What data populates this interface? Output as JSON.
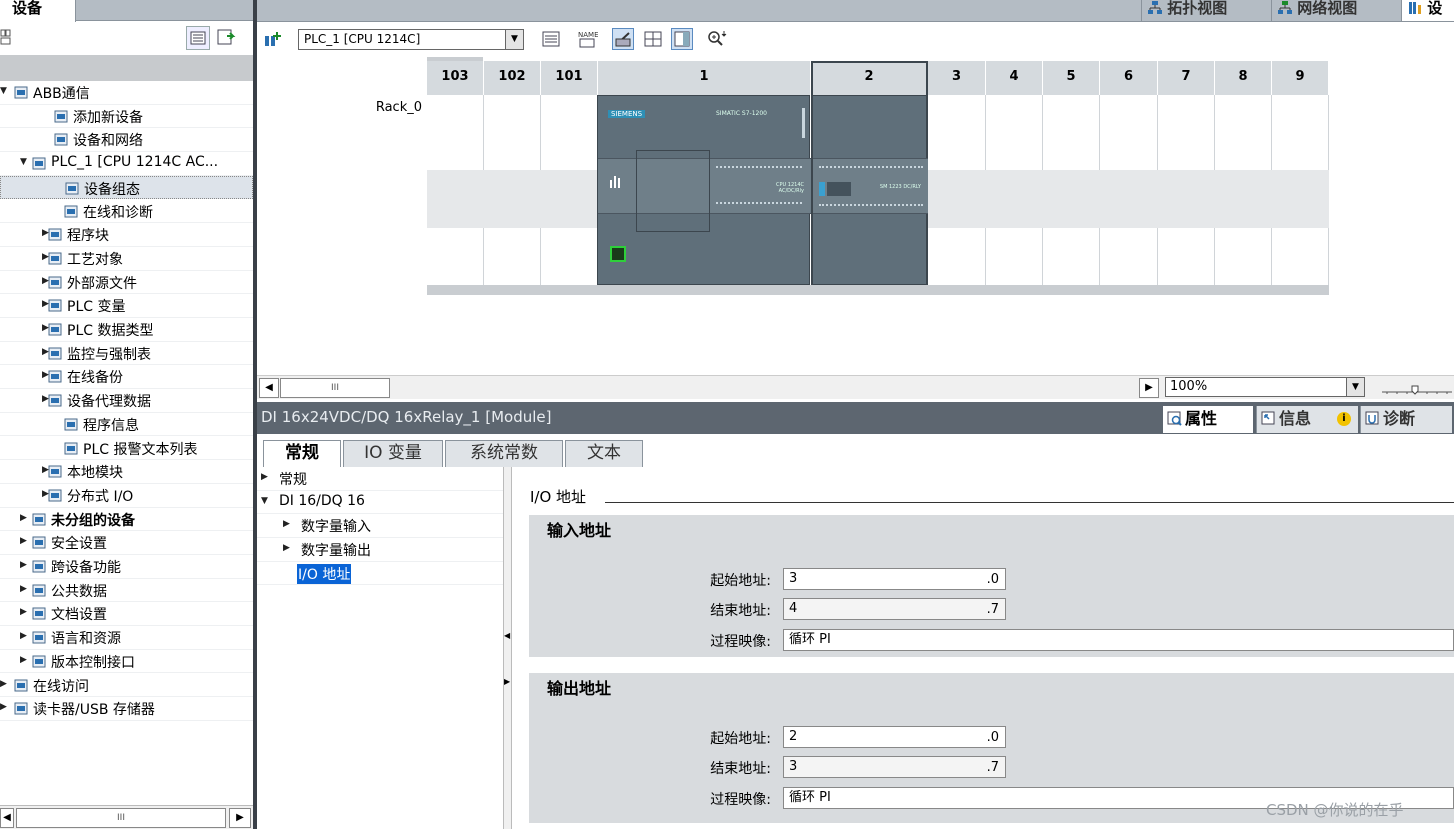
{
  "left_panel": {
    "tab_label": "设备",
    "toolbar_label": "设备",
    "tree": [
      {
        "label": "ABB通信",
        "level": 0,
        "arrow": "▼",
        "icon": "project-icon",
        "bold": false
      },
      {
        "label": "添加新设备",
        "level": 2,
        "arrow": "",
        "icon": "add-device-icon",
        "bold": false
      },
      {
        "label": "设备和网络",
        "level": 2,
        "arrow": "",
        "icon": "network-icon",
        "bold": false
      },
      {
        "label": "PLC_1 [CPU 1214C AC...",
        "level": 1,
        "arrow": "▼",
        "icon": "plc-icon",
        "bold": false
      },
      {
        "label": "设备组态",
        "level": 3,
        "arrow": "",
        "icon": "device-config-icon",
        "bold": false,
        "selected": true
      },
      {
        "label": "在线和诊断",
        "level": 3,
        "arrow": "",
        "icon": "diagnostics-icon",
        "bold": false
      },
      {
        "label": "程序块",
        "level": 2,
        "arrow": "▶",
        "icon": "program-blocks-icon",
        "bold": false
      },
      {
        "label": "工艺对象",
        "level": 2,
        "arrow": "▶",
        "icon": "technology-objects-icon",
        "bold": false
      },
      {
        "label": "外部源文件",
        "level": 2,
        "arrow": "▶",
        "icon": "external-source-icon",
        "bold": false
      },
      {
        "label": "PLC 变量",
        "level": 2,
        "arrow": "▶",
        "icon": "plc-tags-icon",
        "bold": false
      },
      {
        "label": "PLC 数据类型",
        "level": 2,
        "arrow": "▶",
        "icon": "plc-datatypes-icon",
        "bold": false
      },
      {
        "label": "监控与强制表",
        "level": 2,
        "arrow": "▶",
        "icon": "watch-table-icon",
        "bold": false
      },
      {
        "label": "在线备份",
        "level": 2,
        "arrow": "▶",
        "icon": "online-backup-icon",
        "bold": false
      },
      {
        "label": "设备代理数据",
        "level": 2,
        "arrow": "▶",
        "icon": "device-proxy-icon",
        "bold": false
      },
      {
        "label": "程序信息",
        "level": 3,
        "arrow": "",
        "icon": "program-info-icon",
        "bold": false
      },
      {
        "label": "PLC 报警文本列表",
        "level": 3,
        "arrow": "",
        "icon": "alarm-text-icon",
        "bold": false
      },
      {
        "label": "本地模块",
        "level": 2,
        "arrow": "▶",
        "icon": "local-modules-icon",
        "bold": false
      },
      {
        "label": "分布式 I/O",
        "level": 2,
        "arrow": "▶",
        "icon": "distributed-io-icon",
        "bold": false
      },
      {
        "label": "未分组的设备",
        "level": 1,
        "arrow": "▶",
        "icon": "ungrouped-devices-icon",
        "bold": true
      },
      {
        "label": "安全设置",
        "level": 1,
        "arrow": "▶",
        "icon": "security-icon",
        "bold": false
      },
      {
        "label": "跨设备功能",
        "level": 1,
        "arrow": "▶",
        "icon": "cross-device-icon",
        "bold": false
      },
      {
        "label": "公共数据",
        "level": 1,
        "arrow": "▶",
        "icon": "common-data-icon",
        "bold": false
      },
      {
        "label": "文档设置",
        "level": 1,
        "arrow": "▶",
        "icon": "document-settings-icon",
        "bold": false
      },
      {
        "label": "语言和资源",
        "level": 1,
        "arrow": "▶",
        "icon": "languages-icon",
        "bold": false
      },
      {
        "label": "版本控制接口",
        "level": 1,
        "arrow": "▶",
        "icon": "version-control-icon",
        "bold": false
      },
      {
        "label": "在线访问",
        "level": 0,
        "arrow": "▶",
        "icon": "online-access-icon",
        "bold": false
      },
      {
        "label": "读卡器/USB 存储器",
        "level": 0,
        "arrow": "▶",
        "icon": "card-reader-icon",
        "bold": false
      }
    ],
    "hscroll_thumb": "III"
  },
  "view_tabs": [
    {
      "label": "拓扑视图",
      "icon": "topology-icon"
    },
    {
      "label": "网络视图",
      "icon": "network-view-icon"
    },
    {
      "label": "设",
      "icon": "device-view-icon"
    }
  ],
  "device_toolbar": {
    "plc_select": "PLC_1 [CPU 1214C]",
    "icons": [
      "select-device-icon",
      "dropdown-arrow-icon",
      "module-overview-icon",
      "name-icon",
      "show-modules-icon",
      "grid-icon",
      "panel-icon",
      "zoom-icon"
    ]
  },
  "rack": {
    "name": "Rack_0",
    "slots": [
      "103",
      "102",
      "101",
      "1",
      "2",
      "3",
      "4",
      "5",
      "6",
      "7",
      "8",
      "9"
    ],
    "cpu_brand": "SIEMENS",
    "cpu_model": "SIMATIC S7-1200",
    "cpu_type": "CPU 1214C AC/DC/Rly",
    "sm_model": "SM 1223 DC/RLY"
  },
  "zoom": {
    "value": "100%"
  },
  "inspector": {
    "title": "DI 16x24VDC/DQ 16xRelay_1 [Module]",
    "tabs": [
      {
        "label": "属性",
        "icon": "properties-icon",
        "active": true
      },
      {
        "label": "信息",
        "icon": "info-icon",
        "active": false
      },
      {
        "label": "诊断",
        "icon": "diagnostics-tab-icon",
        "active": false
      }
    ],
    "prop_tabs": [
      "常规",
      "IO 变量",
      "系统常数",
      "文本"
    ],
    "nav": [
      {
        "label": "常规",
        "arrow": "▶",
        "level": 0
      },
      {
        "label": "DI 16/DQ 16",
        "arrow": "▼",
        "level": 0
      },
      {
        "label": "数字量输入",
        "arrow": "▶",
        "level": 1
      },
      {
        "label": "数字量输出",
        "arrow": "▶",
        "level": 1
      },
      {
        "label": "I/O 地址",
        "arrow": "",
        "level": 2,
        "selected": true
      }
    ],
    "section_title": "I/O 地址",
    "input": {
      "heading": "输入地址",
      "start_label": "起始地址:",
      "start_value": "3",
      "start_suffix": ".0",
      "end_label": "结束地址:",
      "end_value": "4",
      "end_suffix": ".7",
      "image_label": "过程映像:",
      "image_value": "循环 PI"
    },
    "output": {
      "heading": "输出地址",
      "start_label": "起始地址:",
      "start_value": "2",
      "start_suffix": ".0",
      "end_label": "结束地址:",
      "end_value": "3",
      "end_suffix": ".7",
      "image_label": "过程映像:",
      "image_value": "循环 PI"
    }
  },
  "watermark": "CSDN @你说的在乎",
  "colors": {
    "title_bar": "#5d6670",
    "section_bg": "#d8dbde",
    "module_body": "#5f6f7a",
    "selection": "#0a64d6"
  }
}
